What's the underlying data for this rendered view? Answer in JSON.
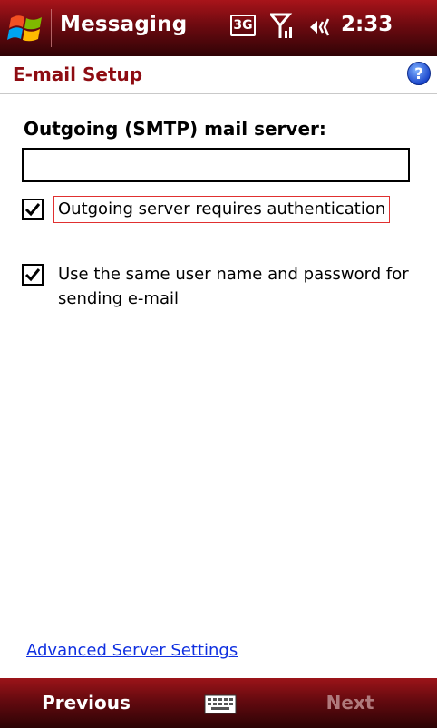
{
  "titlebar": {
    "app_title": "Messaging",
    "network_badge": "3G",
    "time": "2:33",
    "start_icon": "windows-start-icon",
    "signal_icon": "signal-strength-icon",
    "volume_icon": "volume-icon"
  },
  "header": {
    "title": "E-mail Setup",
    "help_icon": "help-icon"
  },
  "form": {
    "server_label": "Outgoing (SMTP) mail server:",
    "server_value": "",
    "requires_auth": {
      "label": "Outgoing server requires authentication",
      "checked": true
    },
    "same_credentials": {
      "label": "Use the same user name and password for sending e-mail",
      "checked": true
    },
    "advanced_link": "Advanced Server Settings"
  },
  "softkeys": {
    "left": "Previous",
    "right": "Next",
    "middle_icon": "keyboard-icon"
  },
  "colors": {
    "bar_red": "#8a0f14",
    "title_red": "#8e0c12",
    "link_blue": "#1030e0",
    "focus_red": "#e03030"
  }
}
